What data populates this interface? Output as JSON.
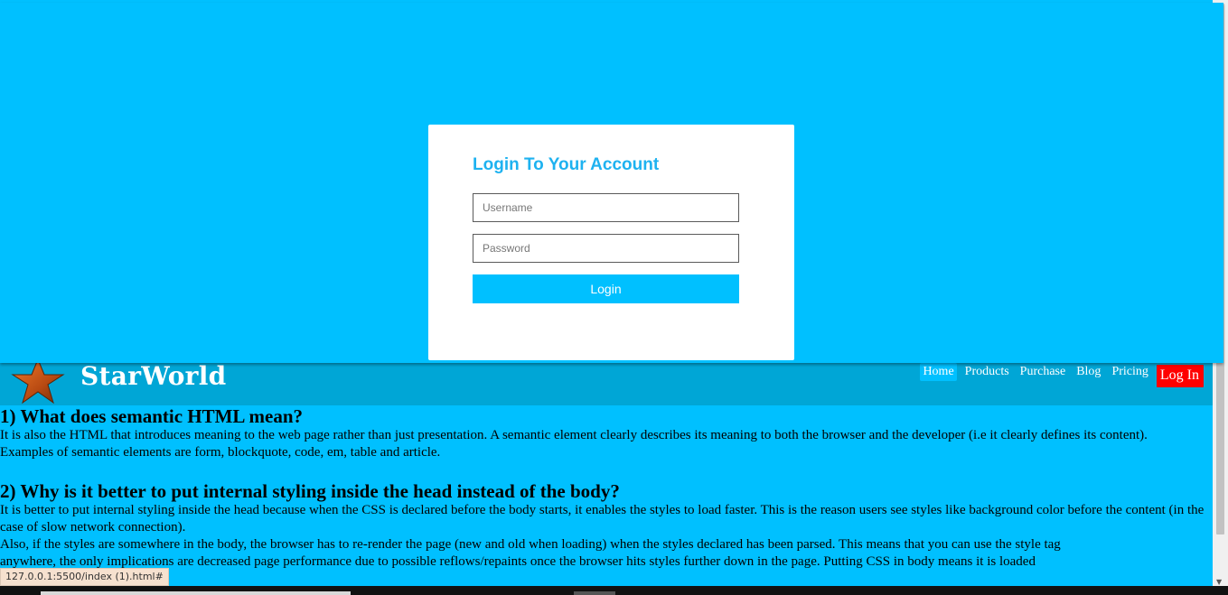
{
  "header": {
    "brand": "StarWorld",
    "logo_icon": "star-icon",
    "nav": {
      "home": "Home",
      "products": "Products",
      "purchase": "Purchase",
      "blog": "Blog",
      "pricing": "Pricing",
      "login": "Log In"
    }
  },
  "content": {
    "q1_title": "1) What does semantic HTML mean?",
    "q1_p1": "It is also the HTML that introduces meaning to the web page rather than just presentation. A semantic element clearly describes its meaning to both the browser and the developer (i.e it clearly defines its content).",
    "q1_p2": "Examples of semantic elements are form, blockquote, code, em, table and article.",
    "q2_title": "2) Why is it better to put internal styling inside the head instead of the body?",
    "q2_p1": "It is better to put internal styling inside the head because when the CSS is declared before the body starts, it enables the styles to load faster. This is the reason users see styles like background color before the content (in the case of slow network connection).",
    "q2_p2": "Also, if the styles are somewhere in the body, the browser has to re-render the page (new and old when loading) when the styles declared has been parsed. This means that you can use the style tag",
    "q2_p3": "anywhere, the only implications are decreased page performance due to possible reflows/repaints once the browser hits styles further down in the page. Putting CSS in body means it is loaded"
  },
  "modal": {
    "title": "Login To Your Account",
    "username_placeholder": "Username",
    "password_placeholder": "Password",
    "login_label": "Login"
  },
  "status_bar": {
    "url": "127.0.0.1:5500/index (1).html#"
  },
  "colors": {
    "page_bg": "#00c0ff",
    "header_bg": "#00a6d6",
    "title_blue": "#1eb2f0",
    "login_red": "#ff0000"
  }
}
